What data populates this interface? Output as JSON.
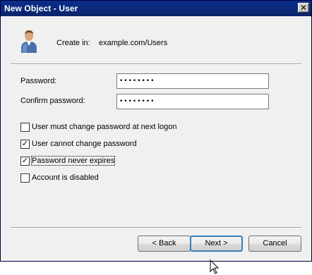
{
  "window": {
    "title": "New Object - User",
    "close_glyph": "✕"
  },
  "header": {
    "create_in_label": "Create in:",
    "create_in_path": "example.com/Users",
    "icon": "user-icon"
  },
  "form": {
    "password_label": "Password:",
    "password_value": "••••••••",
    "confirm_label": "Confirm password:",
    "confirm_value": "••••••••"
  },
  "options": [
    {
      "label": "User must change password at next logon",
      "checked": false
    },
    {
      "label": "User cannot change password",
      "checked": true
    },
    {
      "label": "Password never expires",
      "checked": true,
      "focused": true
    },
    {
      "label": "Account is disabled",
      "checked": false
    }
  ],
  "buttons": {
    "back": "< Back",
    "next": "Next >",
    "cancel": "Cancel"
  },
  "colors": {
    "titlebar": "#0a246a",
    "panel": "#f0f0f0",
    "default_button_border": "#3c7fb1"
  }
}
